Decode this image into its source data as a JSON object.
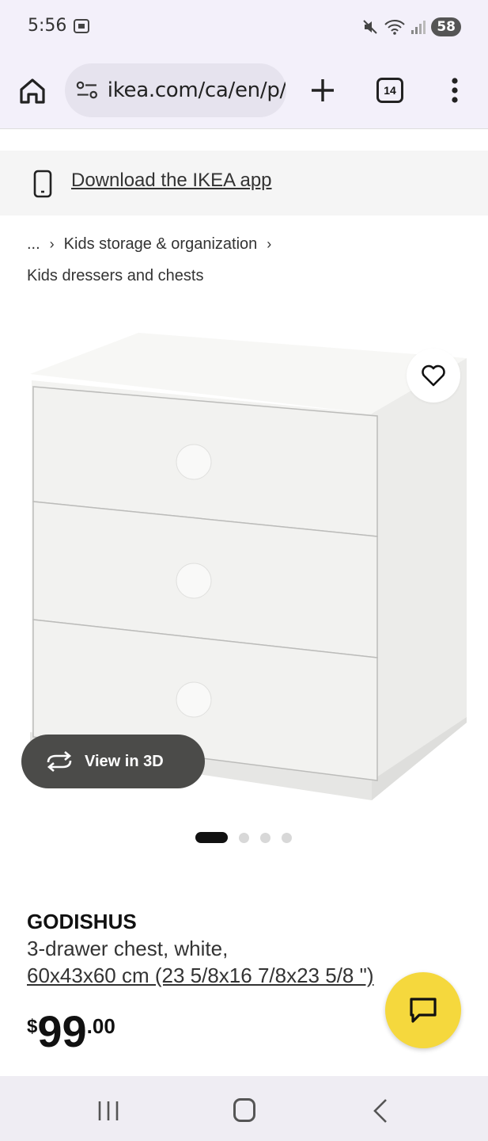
{
  "status_bar": {
    "time": "5:56",
    "battery": "58",
    "icons": [
      "screen-record-icon",
      "mute-icon",
      "wifi-icon",
      "signal-icon"
    ]
  },
  "browser": {
    "url": "ikea.com/ca/en/p/",
    "tab_count": "14",
    "icons": [
      "home-icon",
      "site-info-icon",
      "plus-icon",
      "tabs-icon",
      "more-vertical-icon"
    ]
  },
  "app_banner": {
    "label": "Download the IKEA app",
    "icon": "phone-icon"
  },
  "breadcrumb": {
    "ellipsis": "...",
    "sep": "›",
    "level1": "Kids storage & organization",
    "level2": "Kids dressers and chests"
  },
  "gallery": {
    "view3d_label": "View in 3D",
    "total_images": 4,
    "active_index": 0,
    "product_color": "#f4f4f2"
  },
  "product": {
    "name": "GODISHUS",
    "description": "3-drawer chest, white,",
    "dimensions": "60x43x60 cm (23 5/8x16 7/8x23 5/8 \")",
    "price_currency": "$",
    "price_main": "99",
    "price_cents": ".00"
  },
  "colors": {
    "accent_yellow": "#f5d83d",
    "view3d_bg": "#4b4b49",
    "browser_bg": "#f3f0fa"
  }
}
